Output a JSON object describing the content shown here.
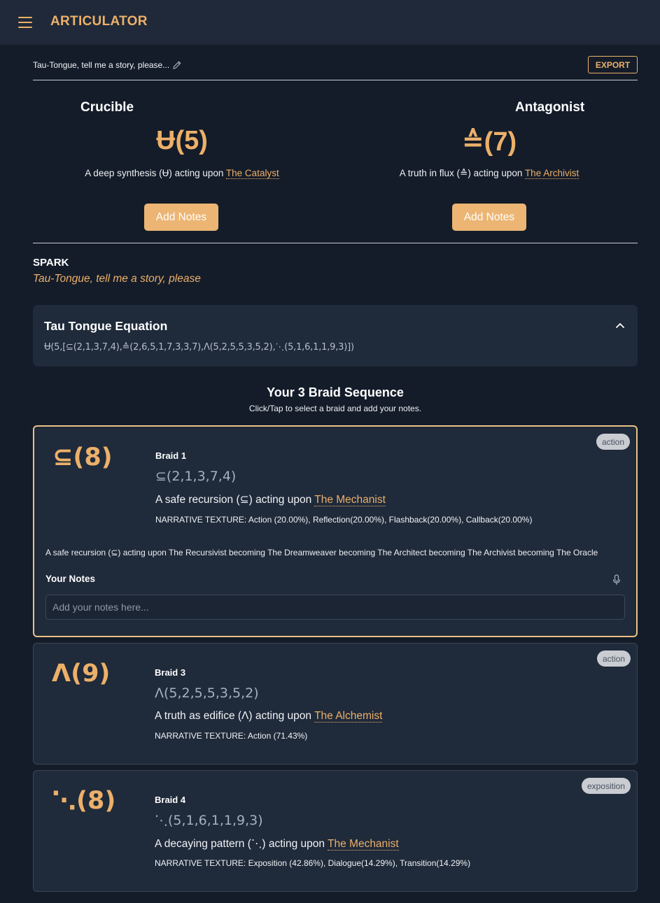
{
  "app": {
    "title": "ARTICULATOR"
  },
  "story": {
    "title": "Tau-Tongue, tell me a story, please...",
    "export_label": "EXPORT"
  },
  "roles": [
    {
      "heading": "Crucible",
      "symbol": "Ʉ(5)",
      "desc_prefix": "A deep synthesis (Ʉ) acting upon ",
      "link": "The Catalyst",
      "button": "Add Notes"
    },
    {
      "heading": "Antagonist",
      "symbol": "≙(7)",
      "desc_prefix": "A truth in flux (≙) acting upon ",
      "link": "The Archivist",
      "button": "Add Notes"
    }
  ],
  "spark": {
    "label": "SPARK",
    "text": "Tau-Tongue, tell me a story, please"
  },
  "equation": {
    "title": "Tau Tongue Equation",
    "text": "Ʉ(5,[⊆(2,1,3,7,4),≙(2,6,5,1,7,3,3,7),Λ(5,2,5,5,3,5,2),⋱(5,1,6,1,1,9,3)])"
  },
  "braids": {
    "heading": "Your 3 Braid Sequence",
    "subheading": "Click/Tap to select a braid and add your notes.",
    "items": [
      {
        "badge": "action",
        "symbol": "⊆(8)",
        "label": "Braid 1",
        "sequence": "⊆(2,1,3,7,4)",
        "desc_prefix": "A safe recursion (⊆) acting upon ",
        "link": "The Mechanist",
        "texture": "NARRATIVE TEXTURE: Action (20.00%), Reflection(20.00%), Flashback(20.00%), Callback(20.00%)",
        "chain": "A safe recursion (⊆) acting upon The Recursivist becoming The Dreamweaver becoming The Architect becoming The Archivist becoming The Oracle",
        "notes_label": "Your Notes",
        "notes_placeholder": "Add your notes here..."
      },
      {
        "badge": "action",
        "symbol": "Λ(9)",
        "label": "Braid 3",
        "sequence": "Λ(5,2,5,5,3,5,2)",
        "desc_prefix": "A truth as edifice (Λ) acting upon ",
        "link": "The Alchemist",
        "texture": "NARRATIVE TEXTURE: Action (71.43%)"
      },
      {
        "badge": "exposition",
        "symbol": "⋱(8)",
        "label": "Braid 4",
        "sequence": "⋱(5,1,6,1,1,9,3)",
        "desc_prefix": "A decaying pattern (⋱) acting upon ",
        "link": "The Mechanist",
        "texture": "NARRATIVE TEXTURE: Exposition (42.86%), Dialogue(14.29%), Transition(14.29%)"
      }
    ]
  }
}
